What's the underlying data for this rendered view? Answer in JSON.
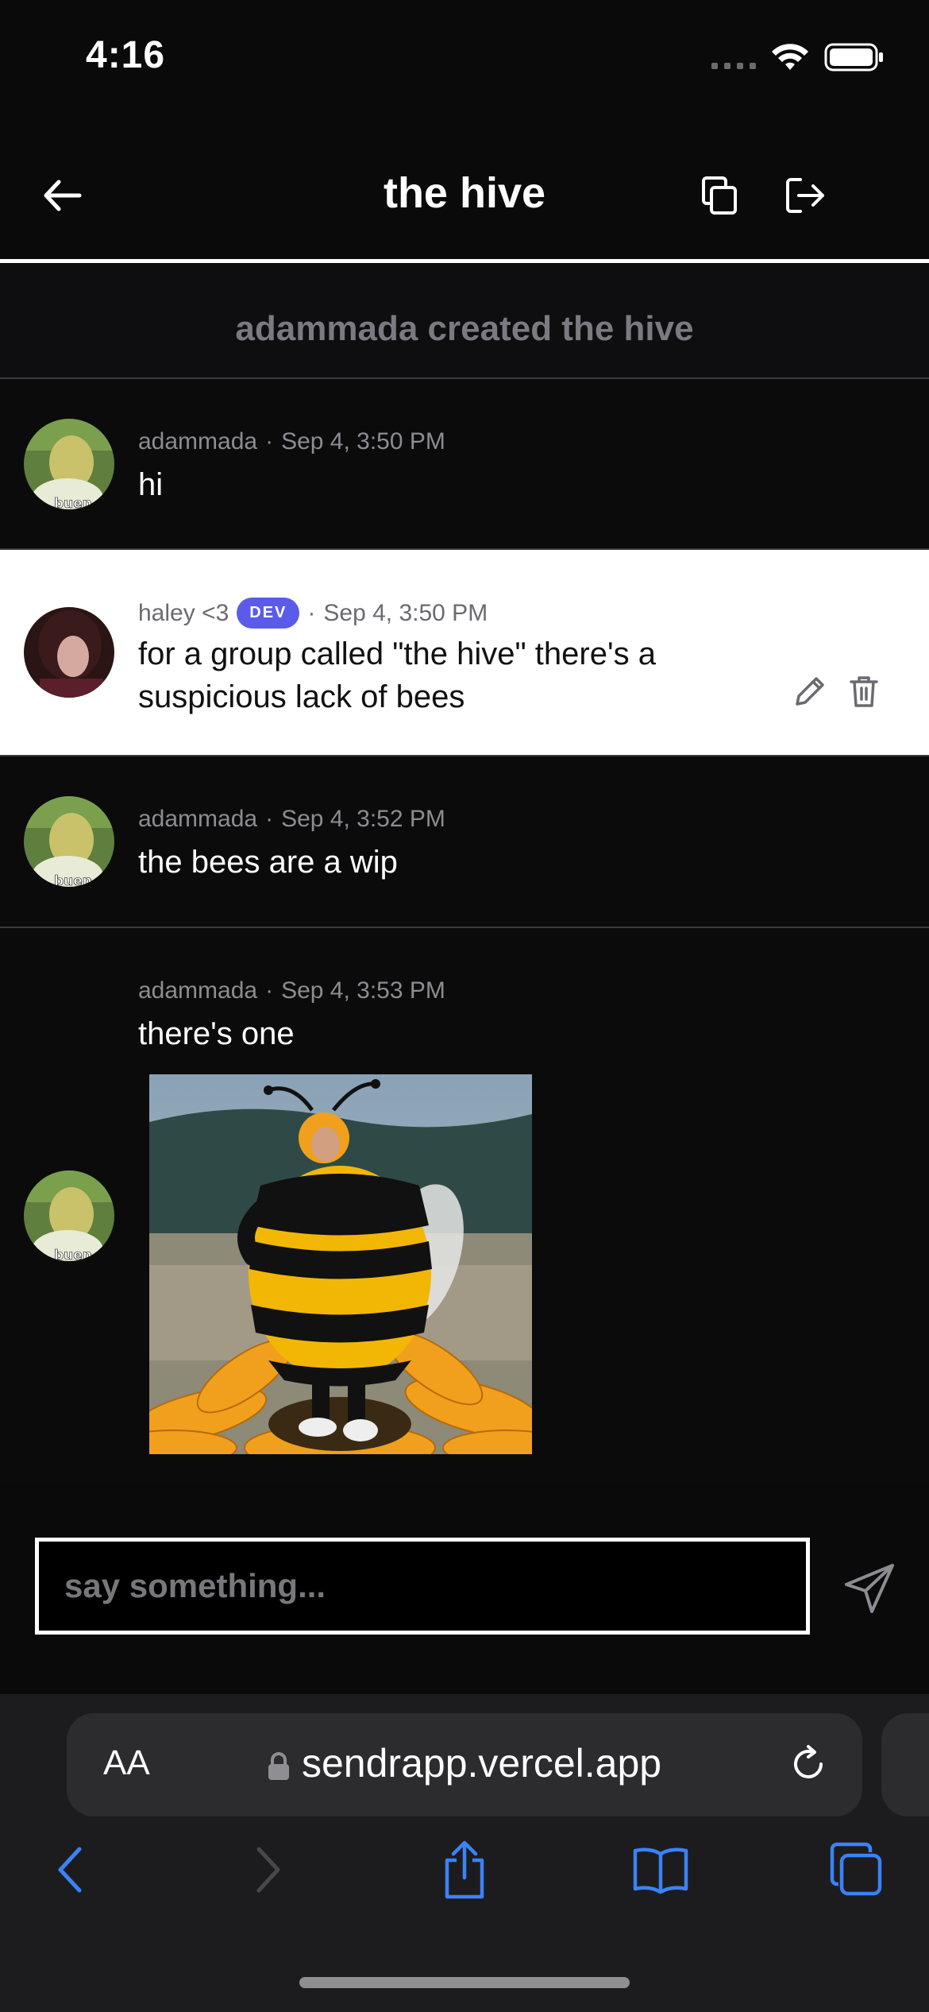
{
  "status_bar": {
    "time": "4:16"
  },
  "header": {
    "title": "the hive"
  },
  "system_message": "adammada created the hive",
  "messages": [
    {
      "author": "adammada",
      "sep": "·",
      "timestamp": "Sep 4, 3:50 PM",
      "text": "hi",
      "avatar_caption": "buen"
    },
    {
      "author": "haley <3",
      "badge": "DEV",
      "sep": "·",
      "timestamp": "Sep 4, 3:50 PM",
      "text_line1": "for a group called \"the hive\" there's a",
      "text_line2": "suspicious lack of bees"
    },
    {
      "author": "adammada",
      "sep": "·",
      "timestamp": "Sep 4, 3:52 PM",
      "text": "the bees are a wip",
      "avatar_caption": "buen"
    },
    {
      "author": "adammada",
      "sep": "·",
      "timestamp": "Sep 4, 3:53 PM",
      "text": "there's one",
      "avatar_caption": "buen"
    }
  ],
  "composer": {
    "placeholder": "say something..."
  },
  "browser": {
    "aa_label": "AA",
    "url": "sendrapp.vercel.app"
  },
  "colors": {
    "background": "#0a0a0b",
    "accent_badge": "#5b5bea",
    "safari_blue": "#3b82f6",
    "muted_text": "#8c8c92"
  },
  "icons": [
    "back-arrow-icon",
    "copy-icon",
    "leave-icon",
    "edit-icon",
    "trash-icon",
    "send-icon",
    "lock-icon",
    "reload-icon",
    "safari-back-icon",
    "safari-forward-icon",
    "share-icon",
    "bookmarks-icon",
    "tabs-icon",
    "wifi-icon",
    "battery-icon"
  ]
}
